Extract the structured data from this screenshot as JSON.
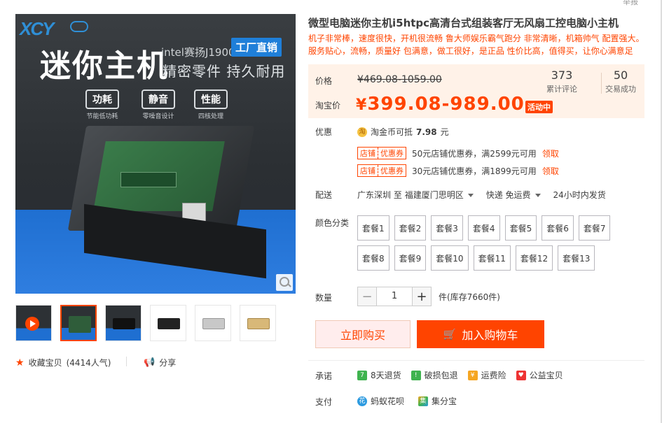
{
  "header": {
    "report_label": "举报"
  },
  "gallery": {
    "hero": {
      "logo": "XCY",
      "title": "迷你主机",
      "intel": "intel赛扬J1900",
      "tag": "工厂直销",
      "subtitle": "精密零件 持久耐用",
      "features": [
        {
          "title": "功耗",
          "sub": "节能低功耗"
        },
        {
          "title": "静音",
          "sub": "零噪音设计"
        },
        {
          "title": "性能",
          "sub": "四核处理"
        }
      ]
    },
    "thumbnails": [
      "video",
      "board",
      "black-case",
      "black-mini",
      "silver-mini",
      "gold-mini"
    ],
    "selected_thumbnail": 1
  },
  "actions": {
    "favorite_label": "收藏宝贝",
    "favorite_count": "(4414人气)",
    "share_label": "分享"
  },
  "product": {
    "title": "微型电脑迷你主机i5htpc高清台式组装客厅无风扇工控电脑小主机",
    "description": "机子非常棒，速度很快，开机很流畅 鲁大师娱乐霸气跑分 非常清晰，机箱帅气 配置强大。服务贴心，流畅，质量好 包满意，做工很好，是正品 性价比高，值得买，让你心满意足"
  },
  "price": {
    "label": "价格",
    "original": "¥469.08-1059.00",
    "tb_label": "淘宝价",
    "currency": "¥",
    "current": "399.08-989.00",
    "activity": "活动中",
    "reviews_count": "373",
    "reviews_label": "累计评论",
    "sales_count": "50",
    "sales_label": "交易成功"
  },
  "promo": {
    "label": "优惠",
    "coin_text": "淘金币可抵",
    "coin_amount": "7.98",
    "coin_unit": "元",
    "coupons": [
      {
        "tag_a": "店铺",
        "tag_b": "优惠券",
        "text": "50元店铺优惠券，满2599元可用",
        "action": "领取"
      },
      {
        "tag_a": "店铺",
        "tag_b": "优惠券",
        "text": "30元店铺优惠券，满1899元可用",
        "action": "领取"
      }
    ]
  },
  "shipping": {
    "label": "配送",
    "from": "广东深圳",
    "to_word": "至",
    "to": "福建厦门思明区",
    "method": "快递 免运费",
    "time": "24小时内发货"
  },
  "options": {
    "label": "颜色分类",
    "items": [
      "套餐1",
      "套餐2",
      "套餐3",
      "套餐4",
      "套餐5",
      "套餐6",
      "套餐7",
      "套餐8",
      "套餐9",
      "套餐10",
      "套餐11",
      "套餐12",
      "套餐13"
    ]
  },
  "quantity": {
    "label": "数量",
    "value": "1",
    "stock": "件(库存7660件)",
    "minus": "−",
    "plus": "+"
  },
  "buttons": {
    "buy_now": "立即购买",
    "add_cart": "加入购物车"
  },
  "promise": {
    "label": "承诺",
    "items": [
      "8天退货",
      "破损包退",
      "运费险",
      "公益宝贝"
    ]
  },
  "payment": {
    "label": "支付",
    "items": [
      "蚂蚁花呗",
      "集分宝"
    ]
  },
  "colors": {
    "accent": "#ff4400",
    "price_bg": "#fff2e8"
  }
}
